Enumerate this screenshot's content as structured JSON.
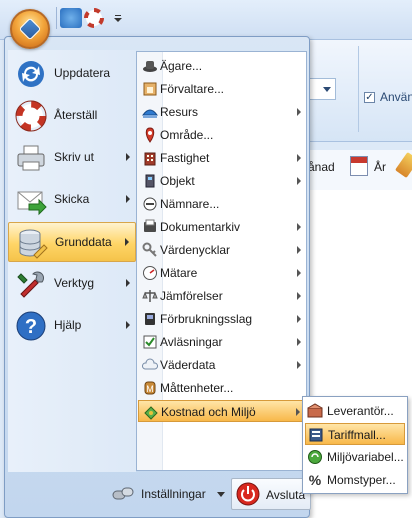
{
  "ribbon": {
    "checkbox_label": "Använ",
    "checkbox_checked": "✓",
    "tab_month": "ånad",
    "tab_year": "År"
  },
  "main_menu": {
    "items": [
      {
        "label": "Uppdatera",
        "icon": "refresh-icon",
        "has_arrow": false
      },
      {
        "label": "Återställ",
        "icon": "lifebuoy-icon",
        "has_arrow": false
      },
      {
        "label": "Skriv ut",
        "icon": "printer-icon",
        "has_arrow": true
      },
      {
        "label": "Skicka",
        "icon": "send-mail-icon",
        "has_arrow": true
      },
      {
        "label": "Grunddata",
        "icon": "database-icon",
        "has_arrow": true,
        "highlighted": true
      },
      {
        "label": "Verktyg",
        "icon": "tools-icon",
        "has_arrow": true
      },
      {
        "label": "Hjälp",
        "icon": "help-icon",
        "has_arrow": true
      }
    ]
  },
  "sub_menu": {
    "items": [
      {
        "label": "Ägare...",
        "icon": "owner-hat-icon",
        "has_arrow": false
      },
      {
        "label": "Förvaltare...",
        "icon": "manager-icon",
        "has_arrow": false
      },
      {
        "label": "Resurs",
        "icon": "resource-icon",
        "has_arrow": true
      },
      {
        "label": "Område...",
        "icon": "area-icon",
        "has_arrow": false
      },
      {
        "label": "Fastighet",
        "icon": "property-icon",
        "has_arrow": true
      },
      {
        "label": "Objekt",
        "icon": "object-icon",
        "has_arrow": true
      },
      {
        "label": "Nämnare...",
        "icon": "denominator-icon",
        "has_arrow": false
      },
      {
        "label": "Dokumentarkiv",
        "icon": "document-archive-icon",
        "has_arrow": true
      },
      {
        "label": "Värdenycklar",
        "icon": "value-keys-icon",
        "has_arrow": true
      },
      {
        "label": "Mätare",
        "icon": "meter-icon",
        "has_arrow": true
      },
      {
        "label": "Jämförelser",
        "icon": "comparison-icon",
        "has_arrow": true
      },
      {
        "label": "Förbrukningsslag",
        "icon": "consumption-type-icon",
        "has_arrow": true
      },
      {
        "label": "Avläsningar",
        "icon": "readings-icon",
        "has_arrow": true
      },
      {
        "label": "Väderdata",
        "icon": "weather-icon",
        "has_arrow": true
      },
      {
        "label": "Måttenheter...",
        "icon": "units-icon",
        "has_arrow": false
      },
      {
        "label": "Kostnad och Miljö",
        "icon": "cost-environment-icon",
        "has_arrow": true,
        "highlighted": true
      }
    ]
  },
  "flyout": {
    "items": [
      {
        "label": "Leverantör...",
        "icon": "supplier-icon"
      },
      {
        "label": "Tariffmall...",
        "icon": "tariff-template-icon",
        "highlighted": true
      },
      {
        "label": "Miljövariabel...",
        "icon": "environment-variable-icon"
      },
      {
        "label": "Momstyper...",
        "icon": "vat-percent-icon"
      }
    ]
  },
  "bottom": {
    "settings_label": "Inställningar",
    "exit_label": "Avsluta"
  },
  "colors": {
    "highlight": "#ffd567",
    "menu_bg": "#d9e6f5",
    "border": "#7f9dc4"
  }
}
